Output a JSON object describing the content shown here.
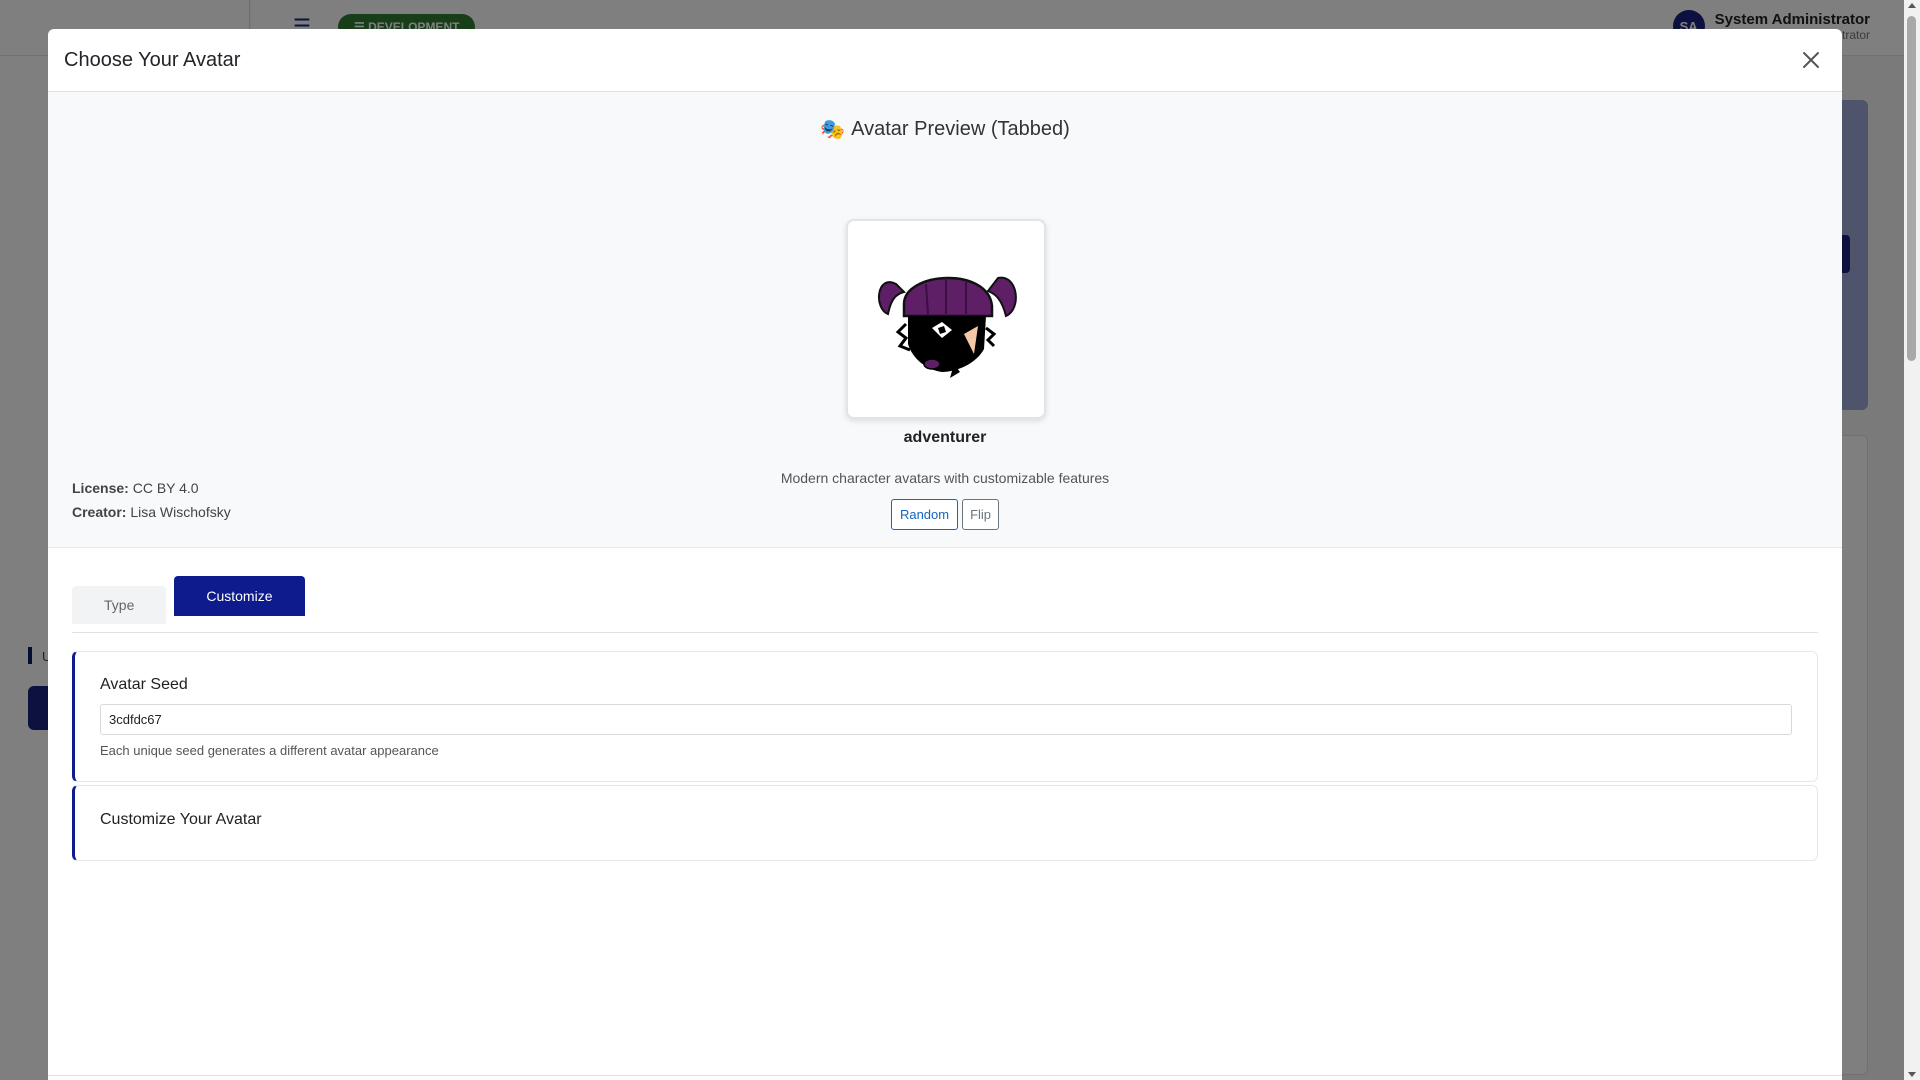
{
  "background": {
    "env_badge": "☰ DEVELOPMENT",
    "user": {
      "initials": "SA",
      "name": "System Administrator",
      "role": "trator"
    },
    "sidebar_letter": "U"
  },
  "modal": {
    "title": "Choose Your Avatar",
    "close_icon": "close-icon",
    "preview": {
      "emoji": "🎭",
      "title": "Avatar Preview (Tabbed)",
      "style_name": "adventurer",
      "description": "Modern character avatars with customizable features",
      "random_label": "Random",
      "flip_label": "Flip",
      "license_label": "License:",
      "license_value": "CC BY 4.0",
      "creator_label": "Creator:",
      "creator_value": "Lisa Wischofsky"
    },
    "tabs": [
      {
        "label": "Type",
        "active": false
      },
      {
        "label": "Customize",
        "active": true
      }
    ],
    "seed_section": {
      "title": "Avatar Seed",
      "value": "3cdfdc67",
      "help": "Each unique seed generates a different avatar appearance"
    },
    "customize_section": {
      "title": "Customize Your Avatar"
    }
  },
  "colors": {
    "primary": "#0d1b8c",
    "link_blue": "#1565c0",
    "badge_green": "#2e7d32",
    "hair_purple": "#5e1f66"
  }
}
